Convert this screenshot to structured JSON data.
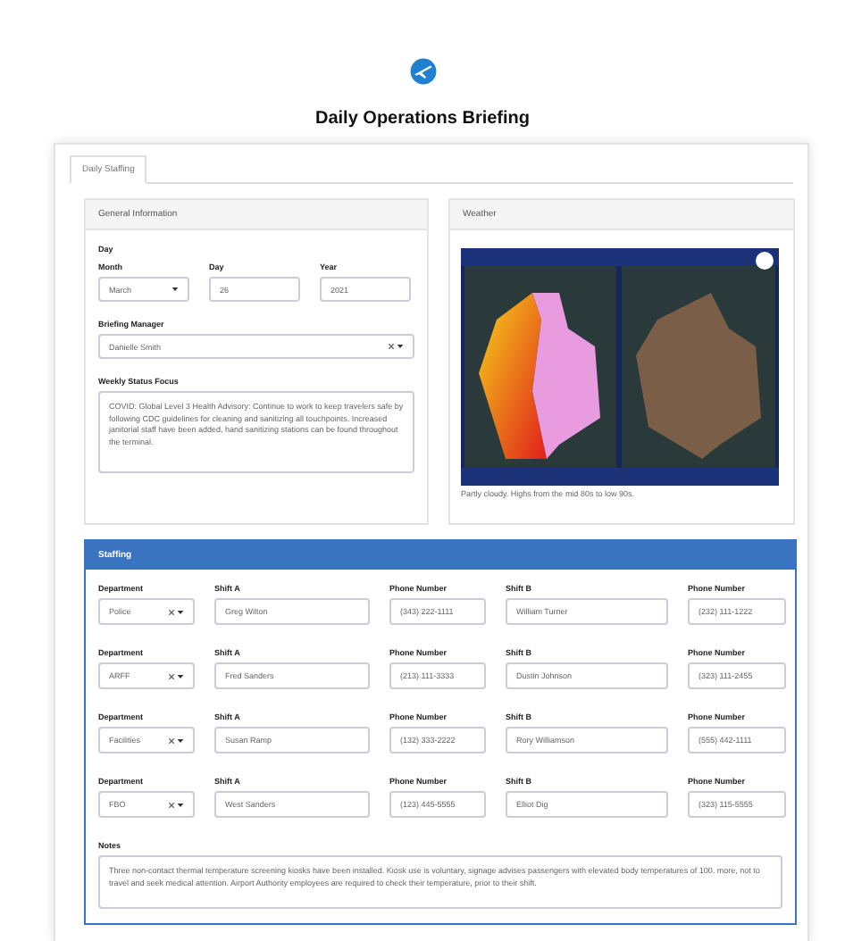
{
  "page_title": "Daily Operations Briefing",
  "tabs": [
    {
      "label": "Daily Staffing",
      "selected": true
    }
  ],
  "general_information": {
    "title": "General Information",
    "day_heading": "Day",
    "date_fields": [
      {
        "kind": "select",
        "label": "Month",
        "value": "March"
      },
      {
        "kind": "text",
        "label": "Day",
        "value": "26"
      },
      {
        "kind": "text",
        "label": "Year",
        "value": "2021"
      }
    ],
    "briefing_manager": {
      "kind": "clearable-select",
      "label": "Briefing Manager",
      "value": "Danielle Smith"
    },
    "weekly_status_focus": {
      "label": "Weekly Status Focus",
      "value": "COVID: Global Level 3 Health Advisory: Continue to work to keep travelers safe by following CDC guidelines for cleaning and sanitizing all touchpoints. Increased janitorial staff have been added, hand sanitizing stations can be found throughout the terminal."
    }
  },
  "weather": {
    "title": "Weather",
    "caption": "Partly cloudy. Highs from the mid 80s to low 90s."
  },
  "staffing": {
    "title": "Staffing",
    "rows": [
      {
        "fields": [
          {
            "kind": "clearable-select",
            "label": "Department",
            "value": "Police"
          },
          {
            "kind": "text",
            "label": "Shift A",
            "value": "Greg Wilton"
          },
          {
            "kind": "text",
            "label": "Phone Number",
            "value": "(343) 222-1111"
          },
          {
            "kind": "text",
            "label": "Shift B",
            "value": "William Turner"
          },
          {
            "kind": "text",
            "label": "Phone Number",
            "value": "(232) 111-1222"
          }
        ]
      },
      {
        "fields": [
          {
            "kind": "clearable-select",
            "label": "Department",
            "value": "ARFF"
          },
          {
            "kind": "text",
            "label": "Shift A",
            "value": "Fred Sanders"
          },
          {
            "kind": "text",
            "label": "Phone Number",
            "value": "(213) 111-3333"
          },
          {
            "kind": "text",
            "label": "Shift B",
            "value": "Dustin Johnson"
          },
          {
            "kind": "text",
            "label": "Phone Number",
            "value": "(323) 111-2455"
          }
        ]
      },
      {
        "fields": [
          {
            "kind": "clearable-select",
            "label": "Department",
            "value": "Facilities"
          },
          {
            "kind": "text",
            "label": "Shift A",
            "value": "Susan Ramp"
          },
          {
            "kind": "text",
            "label": "Phone Number",
            "value": "(132) 333-2222"
          },
          {
            "kind": "text",
            "label": "Shift B",
            "value": "Rory Williamson"
          },
          {
            "kind": "text",
            "label": "Phone Number",
            "value": "(555) 442-1111"
          }
        ]
      },
      {
        "fields": [
          {
            "kind": "clearable-select",
            "label": "Department",
            "value": "FBO"
          },
          {
            "kind": "text",
            "label": "Shift A",
            "value": "West Sanders"
          },
          {
            "kind": "text",
            "label": "Phone Number",
            "value": "(123) 445-5555"
          },
          {
            "kind": "text",
            "label": "Shift B",
            "value": "Elliot Dig"
          },
          {
            "kind": "text",
            "label": "Phone Number",
            "value": "(323) 115-5555"
          }
        ]
      }
    ],
    "notes": {
      "label": "Notes",
      "value": "Three non-contact thermal temperature screening kiosks have been installed. Kiosk use is voluntary, signage advises passengers with elevated body temperatures of 100. more, not to travel and seek medical attention. Airport Authority employees are required to check their temperature, prior to their shift."
    }
  }
}
